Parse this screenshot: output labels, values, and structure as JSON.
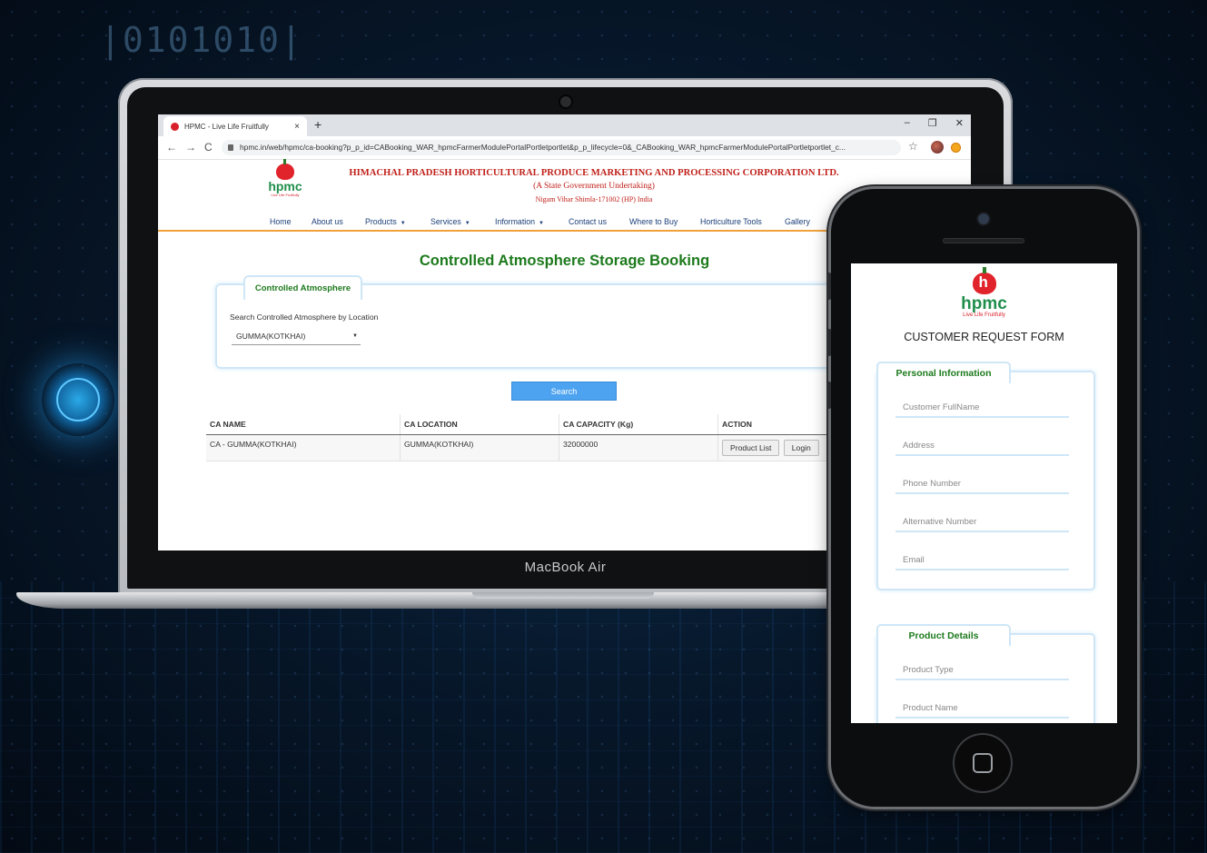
{
  "background": {
    "digits": "|0101010|"
  },
  "laptop": {
    "brand": "MacBook Air",
    "browser": {
      "tab_title": "HPMC - Live Life Fruitfully",
      "tab_close": "×",
      "new_tab": "+",
      "win_minimize": "–",
      "win_restore": "❐",
      "win_close": "✕",
      "back": "←",
      "forward": "→",
      "reload": "C",
      "url": "hpmc.in/web/hpmc/ca-booking?p_p_id=CABooking_WAR_hpmcFarmerModulePortalPortletportlet&p_p_lifecycle=0&_CABooking_WAR_hpmcFarmerModulePortalPortletportlet_c...",
      "star": "☆"
    },
    "site": {
      "logo_text": "hpmc",
      "logo_tagline": "Live Life Fruitfully",
      "org_title": "HIMACHAL PRADESH HORTICULTURAL PRODUCE MARKETING AND PROCESSING CORPORATION LTD.",
      "org_subtitle": "(A State Government Undertaking)",
      "org_address": "Nigam Vihar Shimla-171002 (HP) India",
      "nav": [
        {
          "label": "Home",
          "dropdown": false
        },
        {
          "label": "About us",
          "dropdown": false
        },
        {
          "label": "Products",
          "dropdown": true
        },
        {
          "label": "Services",
          "dropdown": true
        },
        {
          "label": "Information",
          "dropdown": true
        },
        {
          "label": "Contact us",
          "dropdown": false
        },
        {
          "label": "Where to Buy",
          "dropdown": false
        },
        {
          "label": "Horticulture Tools",
          "dropdown": false
        },
        {
          "label": "Gallery",
          "dropdown": false
        }
      ],
      "caret": "▼"
    },
    "page": {
      "title": "Controlled Atmosphere Storage Booking",
      "fieldset_legend": "Controlled Atmosphere",
      "search_label": "Search Controlled Atmosphere by Location",
      "location_value": "GUMMA(KOTKHAI)",
      "search_button": "Search",
      "table": {
        "headers": [
          "CA NAME",
          "CA LOCATION",
          "CA CAPACITY (Kg)",
          "ACTION"
        ],
        "rows": [
          {
            "name": "CA - GUMMA(KOTKHAI)",
            "location": "GUMMA(KOTKHAI)",
            "capacity": "32000000",
            "actions": [
              "Product List",
              "Login"
            ]
          }
        ]
      }
    }
  },
  "phone": {
    "logo_text": "hpmc",
    "logo_tagline": "Live Life Fruitfully",
    "form_title": "CUSTOMER REQUEST FORM",
    "personal_legend": "Personal Information",
    "personal_fields": [
      "Customer FullName",
      "Address",
      "Phone Number",
      "Alternative Number",
      "Email"
    ],
    "product_legend": "Product Details",
    "product_fields": [
      "Product Type",
      "Product Name"
    ]
  }
}
